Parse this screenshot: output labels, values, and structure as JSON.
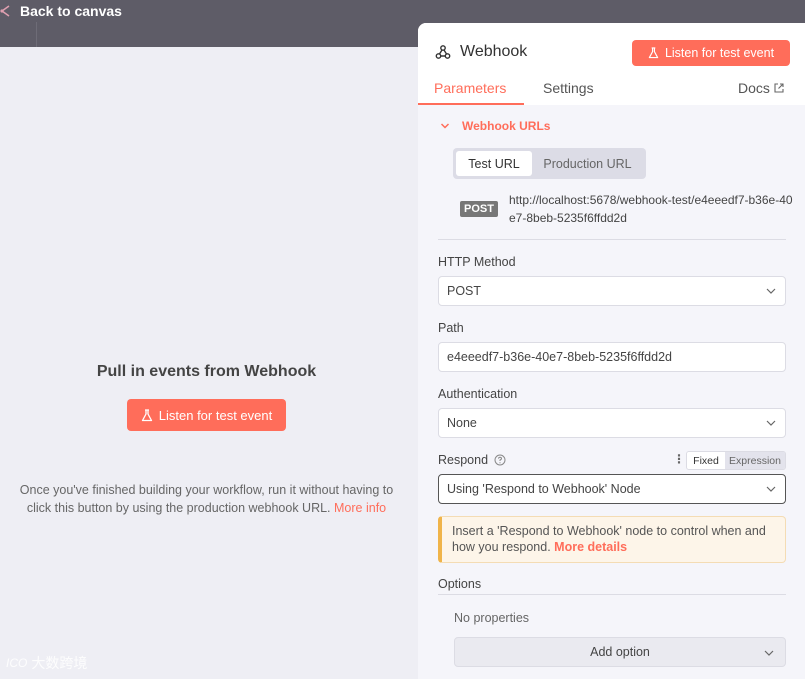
{
  "nav": {
    "back_label": "Back to canvas"
  },
  "canvas_panel": {
    "title": "Pull in events from Webhook",
    "listen_button": "Listen for test event",
    "help_text": "Once you've finished building your workflow, run it without having to click this button by using the production webhook URL.",
    "more_info_link": "More info"
  },
  "watermark": {
    "mark": "ICO",
    "text": "大数跨境"
  },
  "node_panel": {
    "title": "Webhook",
    "listen_button": "Listen for test event",
    "tabs": [
      {
        "label": "Parameters",
        "active": true
      },
      {
        "label": "Settings",
        "active": false
      }
    ],
    "docs_label": "Docs",
    "webhook_urls": {
      "toggle_label": "Webhook URLs",
      "url_tabs": [
        {
          "label": "Test URL",
          "active": true
        },
        {
          "label": "Production URL",
          "active": false
        }
      ],
      "method_badge": "POST",
      "url": "http://localhost:5678/webhook-test/e4eeedf7-b36e-40e7-8beb-5235f6ffdd2d"
    },
    "http_method": {
      "label": "HTTP Method",
      "value": "POST"
    },
    "path": {
      "label": "Path",
      "value": "e4eeedf7-b36e-40e7-8beb-5235f6ffdd2d"
    },
    "authentication": {
      "label": "Authentication",
      "value": "None"
    },
    "respond": {
      "label": "Respond",
      "mode_fixed": "Fixed",
      "mode_expression": "Expression",
      "value": "Using 'Respond to Webhook' Node"
    },
    "notice": {
      "text": "Insert a 'Respond to Webhook' node to control when and how you respond.",
      "link": "More details"
    },
    "options": {
      "label": "Options",
      "empty_text": "No properties",
      "add_button": "Add option"
    }
  },
  "colors": {
    "accent": "#ff6d5a",
    "backdrop": "#5e5c67",
    "panel_bg": "#f5f5fa",
    "notice_border": "#f0b44a"
  }
}
